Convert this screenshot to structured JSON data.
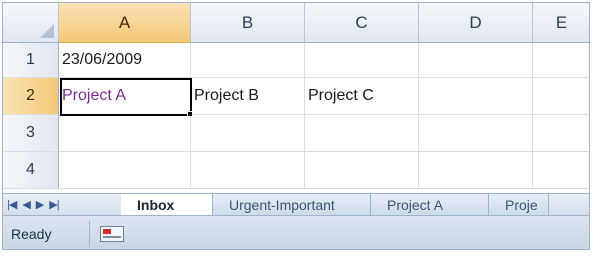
{
  "columns": [
    "A",
    "B",
    "C",
    "D",
    "E"
  ],
  "rows": [
    {
      "label": "1",
      "cells": [
        "23/06/2009",
        "",
        "",
        "",
        ""
      ]
    },
    {
      "label": "2",
      "cells": [
        "Project A",
        "Project B",
        "Project C",
        "",
        ""
      ]
    },
    {
      "label": "3",
      "cells": [
        "",
        "",
        "",
        "",
        ""
      ]
    },
    {
      "label": "4",
      "cells": [
        "",
        "",
        "",
        "",
        ""
      ]
    }
  ],
  "active_cell": "A2",
  "sheet_nav": {
    "first": "|◀",
    "prev": "◀",
    "next": "▶",
    "last": "▶|"
  },
  "sheets": [
    "Inbox",
    "Urgent-Important",
    "Project A",
    "Proje"
  ],
  "active_sheet": "Inbox",
  "status": {
    "text": "Ready",
    "macro_icon": "macro-record-icon"
  },
  "colors": {
    "active_header": "#f4c877",
    "grid_line": "#d6dde6",
    "header_border": "#9fb3cc",
    "link_text": "#7c2d8e"
  }
}
